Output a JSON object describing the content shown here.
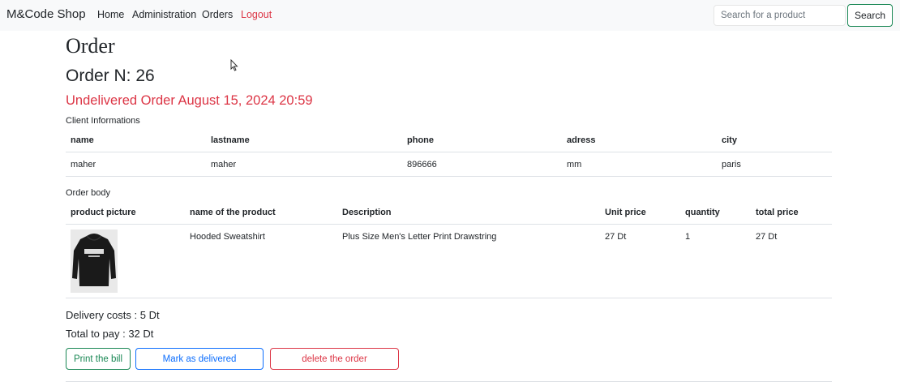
{
  "navbar": {
    "brand": "M&Code Shop",
    "links": [
      "Home",
      "Administration",
      "Orders",
      "Logout"
    ],
    "search_placeholder": "Search for a product",
    "search_button": "Search"
  },
  "page": {
    "title": "Order",
    "order_number": "Order N: 26",
    "status": "Undelivered Order August 15, 2024 20:59"
  },
  "client": {
    "label": "Client Informations",
    "headers": [
      "name",
      "lastname",
      "phone",
      "adress",
      "city"
    ],
    "row": [
      "maher",
      "maher",
      "896666",
      "mm",
      "paris"
    ]
  },
  "order_body": {
    "label": "Order body",
    "headers": [
      "product picture",
      "name of the product",
      "Description",
      "Unit price",
      "quantity",
      "total price"
    ],
    "items": [
      {
        "image_icon": "hoodie-image",
        "name": "Hooded Sweatshirt",
        "description": "Plus Size Men's Letter Print Drawstring",
        "unit_price": "27 Dt",
        "quantity": "1",
        "total": "27 Dt"
      }
    ]
  },
  "summary": {
    "delivery": "Delivery costs : 5 Dt",
    "total": "Total to pay : 32 Dt"
  },
  "actions": {
    "print": "Print the bill",
    "deliver": "Mark as delivered",
    "delete": "delete the order"
  },
  "colors": {
    "danger": "#dc3545",
    "success": "#198754",
    "primary": "#0d6efd"
  }
}
